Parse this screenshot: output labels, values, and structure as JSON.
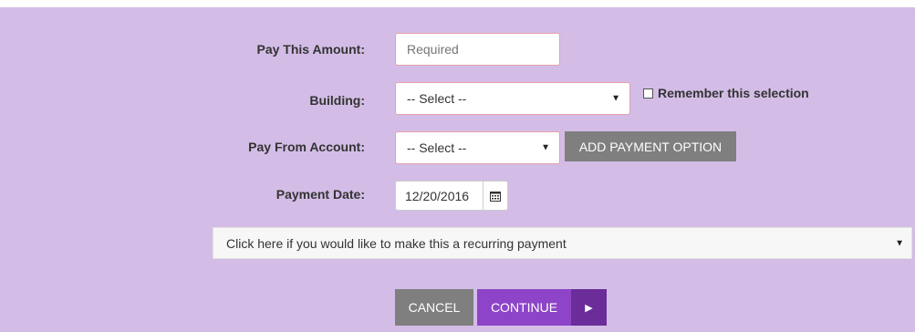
{
  "form": {
    "amount": {
      "label": "Pay This Amount:",
      "placeholder": "Required"
    },
    "building": {
      "label": "Building:",
      "selected": "-- Select --",
      "remember_label": "Remember this selection",
      "remember_checked": false
    },
    "account": {
      "label": "Pay From Account:",
      "selected": "-- Select --",
      "add_button_label": "ADD PAYMENT OPTION"
    },
    "date": {
      "label": "Payment Date:",
      "value": "12/20/2016",
      "icon": "calendar-icon"
    },
    "recurring": {
      "text": "Click here if you would like to make this a recurring payment"
    }
  },
  "actions": {
    "cancel_label": "CANCEL",
    "continue_label": "CONTINUE"
  },
  "colors": {
    "panel_bg": "#d3bde6",
    "required_border": "#e8a0ac",
    "continue_bg": "#8e44c8",
    "continue_arrow_bg": "#6a2d99",
    "gray_button": "#7f7f7f"
  }
}
